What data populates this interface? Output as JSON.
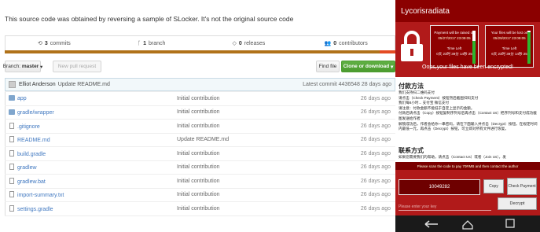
{
  "repo": {
    "description": "This source code was obtained by reversing a sample of SLocker. It's not the original source code",
    "summary": {
      "commits_count": "3",
      "commits_label": "commits",
      "branches_count": "1",
      "branches_label": "branch",
      "releases_count": "0",
      "releases_label": "releases",
      "contributors_count": "0",
      "contributors_label": "contributors"
    },
    "toolbar": {
      "branch_label": "Branch:",
      "branch_value": "master",
      "new_pull_request": "New pull request",
      "find_file": "Find file",
      "clone": "Clone or download"
    },
    "commit": {
      "author": "Elliot Anderson",
      "message": "Update README.md",
      "latest": "Latest commit 4436548 28 days ago"
    },
    "files": [
      {
        "name": "app",
        "type": "folder",
        "message": "Initial contribution",
        "age": "26 days ago"
      },
      {
        "name": "gradle/wrapper",
        "type": "folder",
        "message": "Initial contribution",
        "age": "26 days ago"
      },
      {
        "name": ".gitignore",
        "type": "file",
        "message": "Initial contribution",
        "age": "26 days ago"
      },
      {
        "name": "README.md",
        "type": "file",
        "message": "Update README.md",
        "age": "26 days ago"
      },
      {
        "name": "build.gradle",
        "type": "file",
        "message": "Initial contribution",
        "age": "26 days ago"
      },
      {
        "name": "gradlew",
        "type": "file",
        "message": "Initial contribution",
        "age": "26 days ago"
      },
      {
        "name": "gradlew.bat",
        "type": "file",
        "message": "Initial contribution",
        "age": "26 days ago"
      },
      {
        "name": "import-summary.txt",
        "type": "file",
        "message": "Initial contribution",
        "age": "26 days ago"
      },
      {
        "name": "settings.gradle",
        "type": "file",
        "message": "Initial contribution",
        "age": "26 days ago"
      }
    ]
  },
  "ransom": {
    "title": "Lycorisradiata",
    "timer1": {
      "line1": "Payment will be raised on",
      "line2": "05/27/2017 23:09:05",
      "line3": "Time Left",
      "line4": "0天 23时 39分 14秒 25"
    },
    "timer2": {
      "line1": "Your files will be lost on",
      "line2": "05/29/2017 23:09:05",
      "line3": "Time Left",
      "line4": "6天 23时 39分 14秒 25"
    },
    "oops": "Oops,your files have been encrypted!",
    "section1_title": "付款方法",
    "section1_text": "我们支持扫二维码支付\n请点击（Check Payment）按钮然后截图扫码支付\n我们每8小时... 支付宝 微信支付\n请注意：付款金额不能低于自定上显示的金额。\n付款后请点击（Copy）按钮复制序列号后再点击（Contact Us）把序列号和支付成功截图发送给作者\n解锁成功后，作者会给你一串密码，请在下面输入并点击（Decrypt）按钮，在规定时间内最低一元，再点击（Decrypt）按钮，可立即对所有文件进行恢复。",
    "section2_title": "联系方式",
    "section2_text": "如果您需要我们的帮助，请点击（Contact Us）或者（Join Us），发",
    "scan_hint": "Please scan the code to pay 70RMB and then contact the author",
    "serial": "10049282",
    "copy": "Copy",
    "check_payment": "Check Payment",
    "key_placeholder": "Please enter your key",
    "decrypt": "Decrypt"
  },
  "colors": {
    "link": "#4078c0",
    "ransom_red": "#b11a1a",
    "ransom_dark": "#8b0000",
    "clone_green": "#4a9b2f"
  }
}
